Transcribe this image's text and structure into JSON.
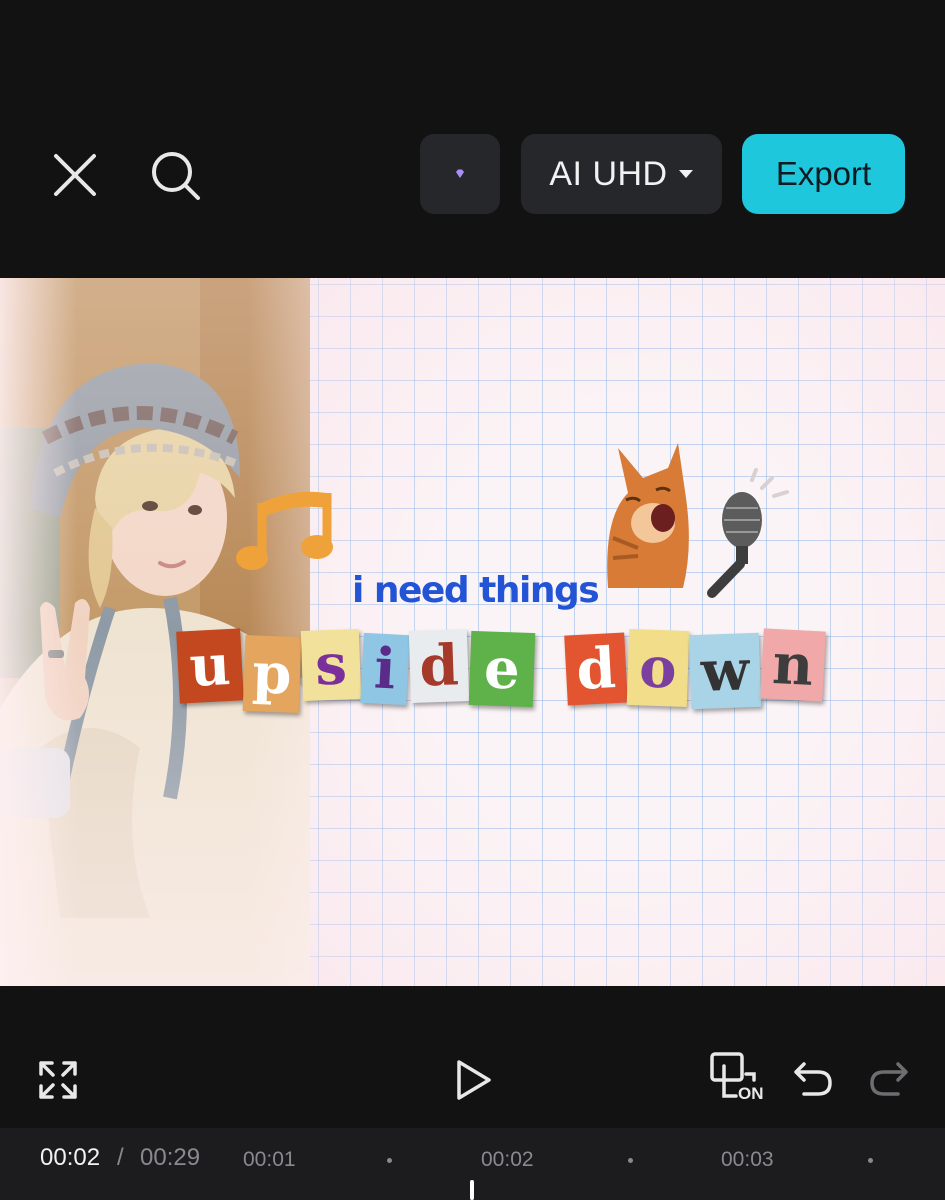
{
  "topbar": {
    "close_icon": "close-icon",
    "search_icon": "search-icon",
    "pro_icon": "diamond-icon",
    "quality_label": "AI UHD",
    "quality_dropdown_icon": "caret-down-icon",
    "export_label": "Export",
    "accent_color": "#1fc7dd"
  },
  "preview": {
    "caption_top": "i need things",
    "ransom_word_1": [
      "u",
      "p",
      "s",
      "i",
      "d",
      "e"
    ],
    "ransom_word_2": [
      "d",
      "o",
      "w",
      "n"
    ],
    "stickers": [
      "music-notes-sticker",
      "singing-cat-sticker",
      "microphone-sticker"
    ]
  },
  "controls": {
    "fullscreen_icon": "fullscreen-icon",
    "play_icon": "play-icon",
    "keyframe_on_label": "ON",
    "undo_icon": "undo-icon",
    "redo_icon": "redo-icon"
  },
  "timeline": {
    "current_time": "00:02",
    "separator": "/",
    "total_time": "00:29",
    "ticks": [
      "00:01",
      "00:02",
      "00:03"
    ]
  }
}
